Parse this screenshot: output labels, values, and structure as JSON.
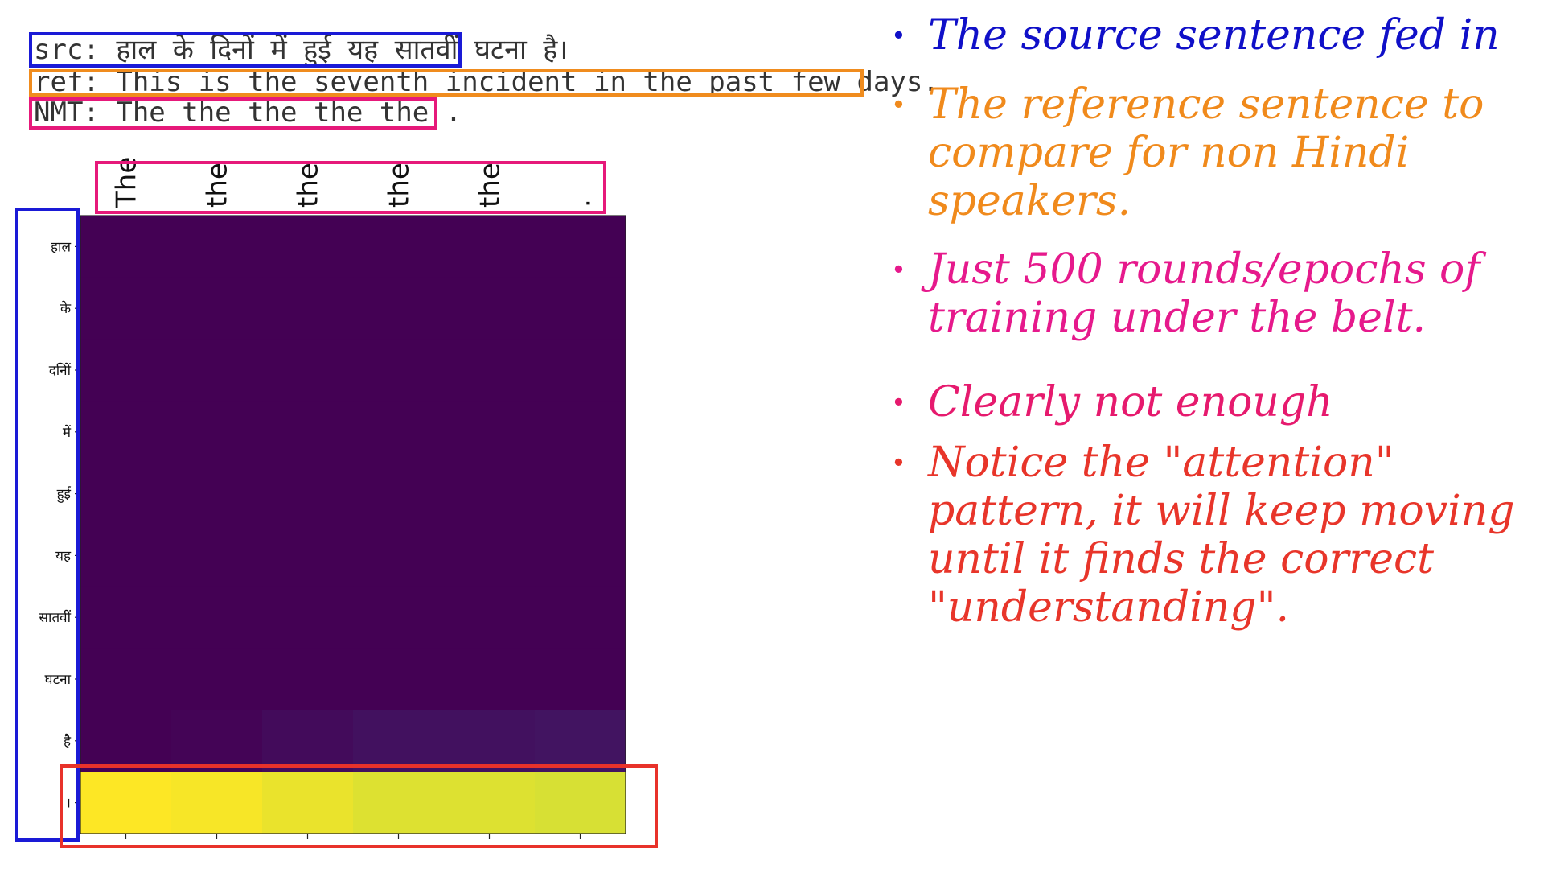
{
  "header": {
    "src_line": "src: हाल के दिनों में हुई यह सातवीं घटना है।",
    "ref_line": "ref: This is the seventh incident in the past few days.",
    "nmt_line": "NMT: The the the the the ."
  },
  "chart_data": {
    "type": "heatmap",
    "title": "",
    "x_tick_labels": [
      "The",
      "the",
      "the",
      "the",
      "the",
      "."
    ],
    "y_tick_labels": [
      "हाल",
      "के",
      "दनिों",
      "में",
      "हुई",
      "यह",
      "सातवीं",
      "घटना",
      "है",
      "।"
    ],
    "values": [
      [
        0.0,
        0.0,
        0.0,
        0.0,
        0.0,
        0.0
      ],
      [
        0.0,
        0.0,
        0.0,
        0.0,
        0.0,
        0.0
      ],
      [
        0.0,
        0.0,
        0.0,
        0.0,
        0.0,
        0.0
      ],
      [
        0.0,
        0.0,
        0.0,
        0.0,
        0.0,
        0.0
      ],
      [
        0.0,
        0.0,
        0.0,
        0.0,
        0.0,
        0.0
      ],
      [
        0.0,
        0.0,
        0.0,
        0.0,
        0.0,
        0.0
      ],
      [
        0.0,
        0.0,
        0.0,
        0.0,
        0.0,
        0.0
      ],
      [
        0.0,
        0.0,
        0.0,
        0.0,
        0.0,
        0.0
      ],
      [
        0.0,
        0.01,
        0.03,
        0.05,
        0.05,
        0.06
      ],
      [
        1.0,
        0.99,
        0.97,
        0.95,
        0.95,
        0.94
      ]
    ],
    "colormap": "viridis",
    "grid": false
  },
  "highlight_colors": {
    "src": "#1a1ad6",
    "ref": "#f08c1e",
    "nmt": "#e6197a",
    "last_row": "#e8322a"
  },
  "notes": [
    {
      "text": "The source sentence fed in",
      "color": "#1010c8"
    },
    {
      "text": "The reference sentence to compare for non Hindi speakers.",
      "color": "#f08a1c"
    },
    {
      "text": "Just 500 rounds/epochs of training under the belt.",
      "color": "#e6198c"
    },
    {
      "text": "Clearly not enough",
      "color": "#e61a6e"
    },
    {
      "text": "Notice the \"attention\" pattern, it will keep moving until it finds the correct \"understanding\".",
      "color": "#e8352a"
    }
  ]
}
